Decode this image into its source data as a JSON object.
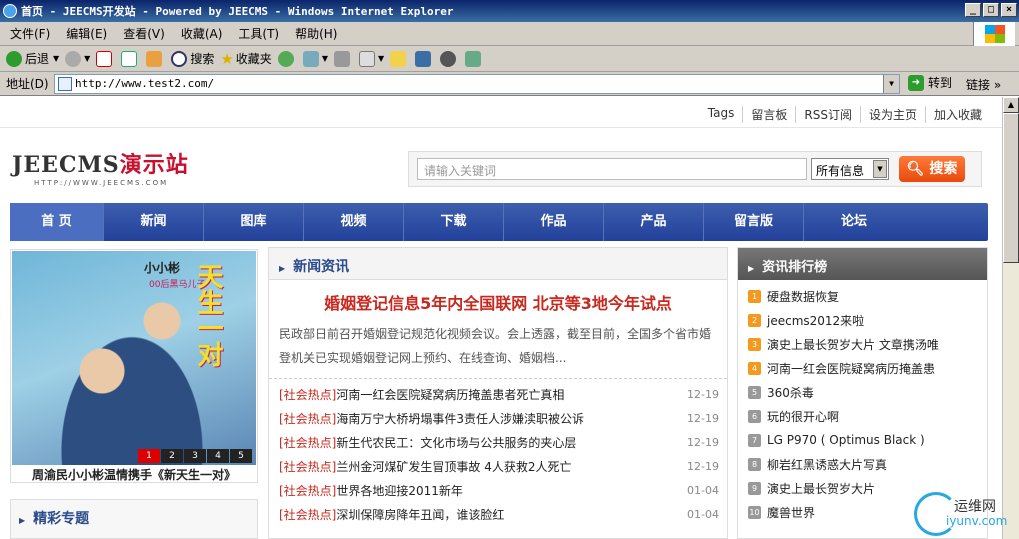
{
  "window": {
    "title": "首页 - JEECMS开发站 - Powered by JEECMS - Windows Internet Explorer",
    "controls": [
      "_",
      "□",
      "×"
    ]
  },
  "menubar": [
    "文件(F)",
    "编辑(E)",
    "查看(V)",
    "收藏(A)",
    "工具(T)",
    "帮助(H)"
  ],
  "toolbar": {
    "back": "后退",
    "search": "搜索",
    "favorites": "收藏夹"
  },
  "addressbar": {
    "label": "地址(D)",
    "url": "http://www.test2.com/",
    "go": "转到",
    "links": "链接"
  },
  "site": {
    "toplinks": [
      "Tags",
      "留言板",
      "RSS订阅",
      "设为主页",
      "加入收藏"
    ],
    "logo": {
      "main": "JEECMS",
      "accent": "演示站",
      "sub": "HTTP://WWW.JEECMS.COM"
    },
    "search": {
      "placeholder": "请输入关键词",
      "scope": "所有信息",
      "button": "搜索"
    },
    "nav": [
      "首 页",
      "新闻",
      "图库",
      "视频",
      "下载",
      "作品",
      "产品",
      "留言版",
      "论坛"
    ],
    "banner": {
      "text1": "小小彬",
      "text2": "00后黑马儿子",
      "text3": "天生一对",
      "pages": [
        "1",
        "2",
        "3",
        "4",
        "5"
      ],
      "active_page": "1",
      "caption": "周渝民小小彬温情携手《新天生一对》"
    },
    "special": {
      "title": "精彩专题"
    },
    "news": {
      "title": "新闻资讯",
      "headline": "婚姻登记信息5年内全国联网 北京等3地今年试点",
      "summary": "民政部日前召开婚姻登记规范化视频会议。会上透露，截至目前，全国多个省市婚登机关已实现婚姻登记网上预约、在线查询、婚姻档...",
      "items": [
        {
          "cat": "[社会热点]",
          "title": "河南一红会医院疑窝病历掩盖患者死亡真相",
          "date": "12-19"
        },
        {
          "cat": "[社会热点]",
          "title": "海南万宁大桥坍塌事件3责任人涉嫌渎职被公诉",
          "date": "12-19"
        },
        {
          "cat": "[社会热点]",
          "title": "新生代农民工：文化市场与公共服务的夹心层",
          "date": "12-19"
        },
        {
          "cat": "[社会热点]",
          "title": "兰州金河煤矿发生冒顶事故 4人获救2人死亡",
          "date": "12-19"
        },
        {
          "cat": "[社会热点]",
          "title": "世界各地迎接2011新年",
          "date": "01-04"
        },
        {
          "cat": "[社会热点]",
          "title": "深圳保障房降年丑闻，谁该脸红",
          "date": "01-04"
        }
      ]
    },
    "ranking": {
      "title": "资讯排行榜",
      "items": [
        {
          "n": "1",
          "title": "硬盘数据恢复"
        },
        {
          "n": "2",
          "title": "jeecms2012来啦"
        },
        {
          "n": "3",
          "title": "演史上最长贺岁大片 文章携汤唯"
        },
        {
          "n": "4",
          "title": "河南一红会医院疑窝病历掩盖患"
        },
        {
          "n": "5",
          "title": "360杀毒"
        },
        {
          "n": "6",
          "title": "玩的很开心啊"
        },
        {
          "n": "7",
          "title": "LG P970 ( Optimus Black )"
        },
        {
          "n": "8",
          "title": "柳岩红黑诱惑大片写真"
        },
        {
          "n": "9",
          "title": "演史上最长贺岁大片"
        },
        {
          "n": "10",
          "title": "魔兽世界"
        }
      ]
    }
  },
  "watermark": {
    "line1": "运维网",
    "line2": "iyunv.com"
  }
}
